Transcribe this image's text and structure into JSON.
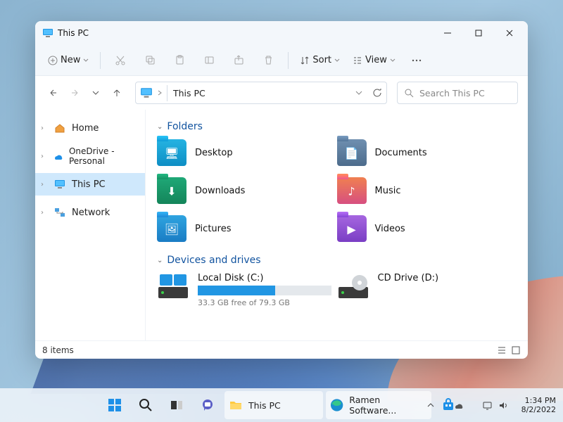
{
  "window": {
    "title": "This PC"
  },
  "toolbar": {
    "new": "New",
    "sort": "Sort",
    "view": "View"
  },
  "address": {
    "path": "This PC"
  },
  "search": {
    "placeholder": "Search This PC"
  },
  "sidebar": {
    "home": "Home",
    "onedrive": "OneDrive - Personal",
    "thispc": "This PC",
    "network": "Network"
  },
  "sections": {
    "folders": "Folders",
    "drives": "Devices and drives"
  },
  "folders": {
    "desktop": "Desktop",
    "documents": "Documents",
    "downloads": "Downloads",
    "music": "Music",
    "pictures": "Pictures",
    "videos": "Videos"
  },
  "drives": {
    "c_name": "Local Disk (C:)",
    "c_sub": "33.3 GB free of 79.3 GB",
    "c_fill_pct": 58,
    "d_name": "CD Drive (D:)"
  },
  "status": {
    "items": "8 items"
  },
  "taskbar": {
    "explorer": "This PC",
    "edge": "Ramen Software..."
  },
  "clock": {
    "time": "1:34 PM",
    "date": "8/2/2022"
  },
  "colors": {
    "blue": "#2196e3",
    "teal": "#17a79a",
    "green": "#2aa04a",
    "orange": "#e0793a",
    "cyan": "#1d9fd6",
    "purple": "#8a4fc8",
    "steel": "#5a7da0"
  }
}
